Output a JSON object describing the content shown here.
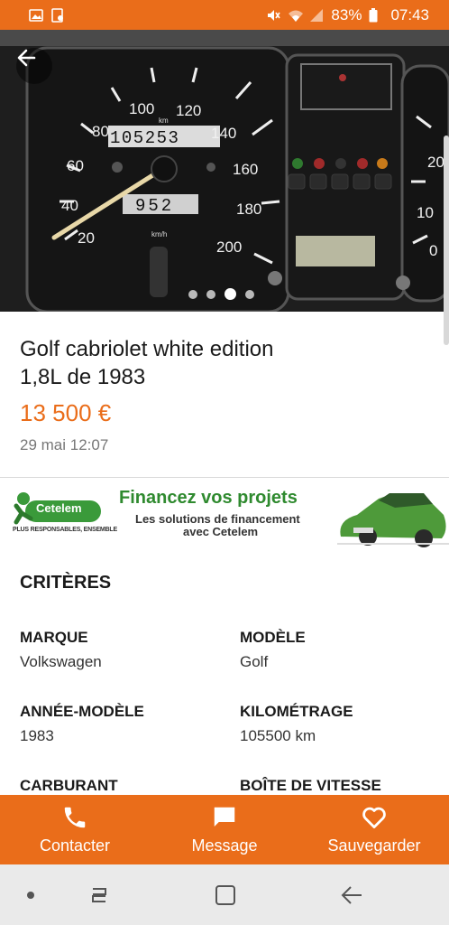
{
  "status_bar": {
    "battery": "83%",
    "time": "07:43",
    "icons": [
      "image-icon",
      "save-icon",
      "mute-icon",
      "wifi-icon",
      "signal-icon",
      "battery-icon"
    ]
  },
  "gallery": {
    "image_count": 4,
    "active_index": 2,
    "photo_text": {
      "speeds": [
        "20",
        "40",
        "60",
        "80",
        "100",
        "120",
        "140",
        "160",
        "180",
        "200"
      ],
      "odometer": "105253",
      "trip": "952",
      "unit": "km/h",
      "km": "km",
      "right_gauge": [
        "20",
        "10",
        "0"
      ]
    }
  },
  "listing": {
    "title_line1": "Golf cabriolet white edition",
    "title_line2": "1,8L de 1983",
    "price": "13 500 €",
    "date": "29 mai 12:07"
  },
  "ad": {
    "logo_text": "Cetelem",
    "tagline": "PLUS RESPONSABLES, ENSEMBLE",
    "headline": "Financez vos projets",
    "sub1": "Les solutions de financement",
    "sub2": "avec Cetelem",
    "colors": {
      "green": "#2f8a2f"
    }
  },
  "criteria": {
    "title": "CRITÈRES",
    "items": [
      {
        "label": "MARQUE",
        "value": "Volkswagen"
      },
      {
        "label": "MODÈLE",
        "value": "Golf"
      },
      {
        "label": "ANNÉE-MODÈLE",
        "value": "1983"
      },
      {
        "label": "KILOMÉTRAGE",
        "value": "105500 km"
      },
      {
        "label": "CARBURANT",
        "value": ""
      },
      {
        "label": "BOÎTE DE VITESSE",
        "value": ""
      }
    ]
  },
  "actions": {
    "contact": "Contacter",
    "message": "Message",
    "save": "Sauvegarder"
  },
  "colors": {
    "brand_orange": "#ea6d1a",
    "text_gray": "#777777"
  }
}
